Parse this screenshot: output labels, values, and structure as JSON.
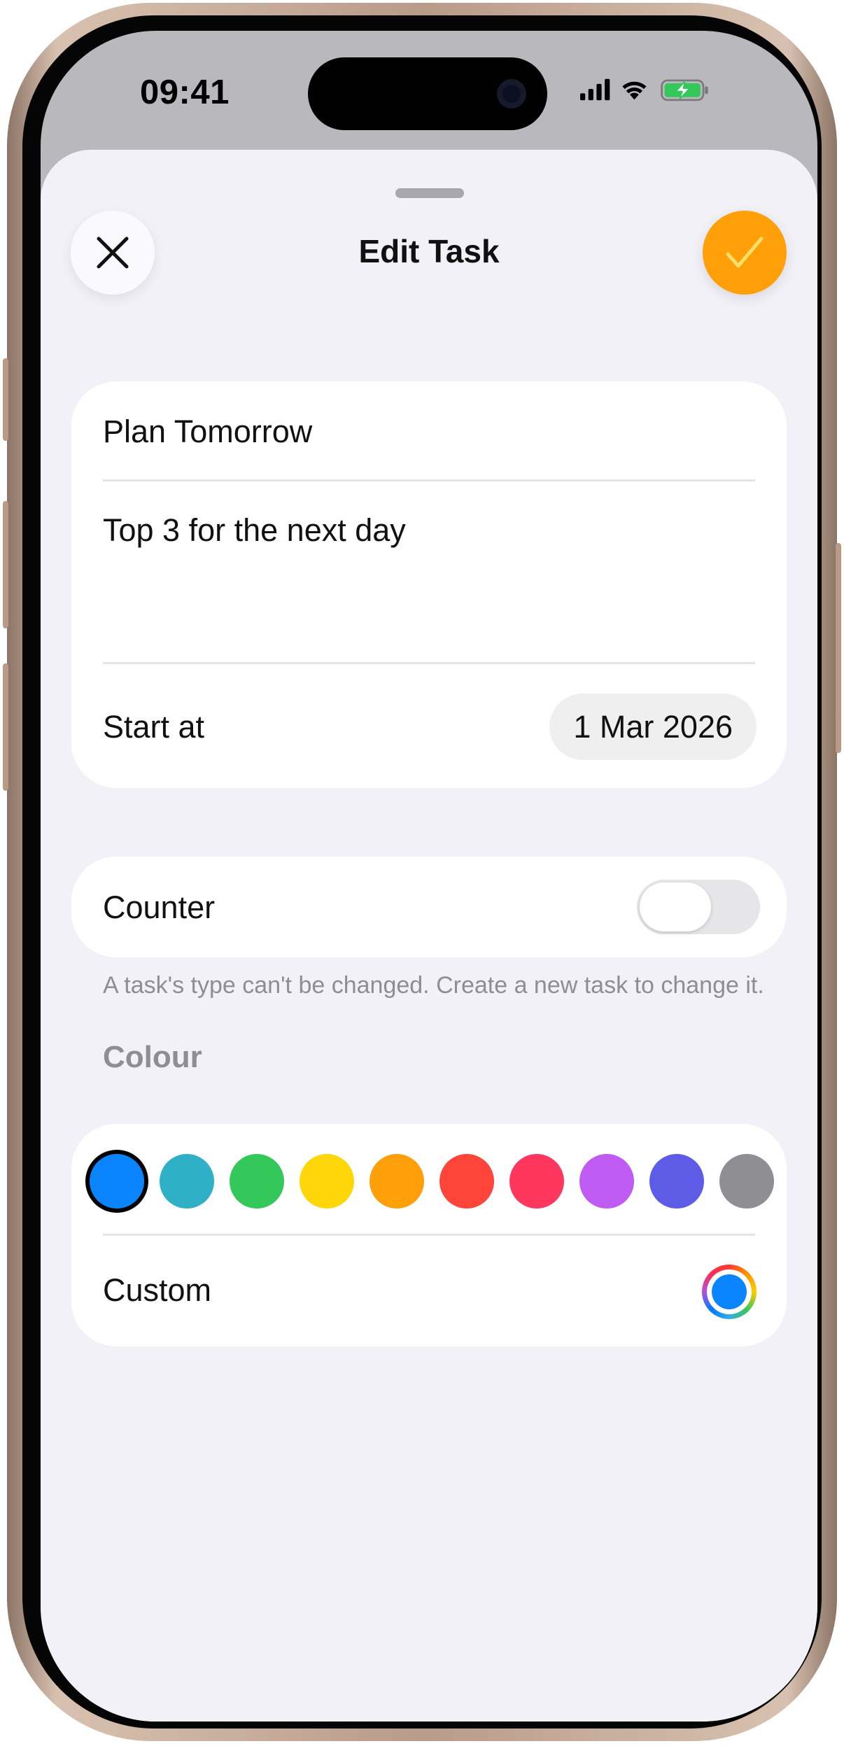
{
  "status_bar": {
    "time": "09:41",
    "icons": [
      "cellular-signal-icon",
      "wifi-icon",
      "battery-charging-icon"
    ]
  },
  "sheet": {
    "title": "Edit Task",
    "close_icon": "close-icon",
    "done_icon": "checkmark-icon",
    "accent_color": "#ff9f0a"
  },
  "task": {
    "name": "Plan Tomorrow",
    "notes": "Top 3 for the next day",
    "start_label": "Start at",
    "start_date": "1 Mar 2026"
  },
  "counter": {
    "label": "Counter",
    "enabled": false
  },
  "footnote": "A task's type can't be changed. Create a new task to change it.",
  "colour": {
    "header": "Colour",
    "swatches": [
      "#0a84ff",
      "#30b0c7",
      "#34c759",
      "#ffd60a",
      "#ff9f0a",
      "#ff453a",
      "#ff375f",
      "#bf5af2",
      "#5e5ce6",
      "#8e8e93"
    ],
    "selected_index": 0,
    "custom_label": "Custom",
    "custom_color": "#0a84ff"
  }
}
